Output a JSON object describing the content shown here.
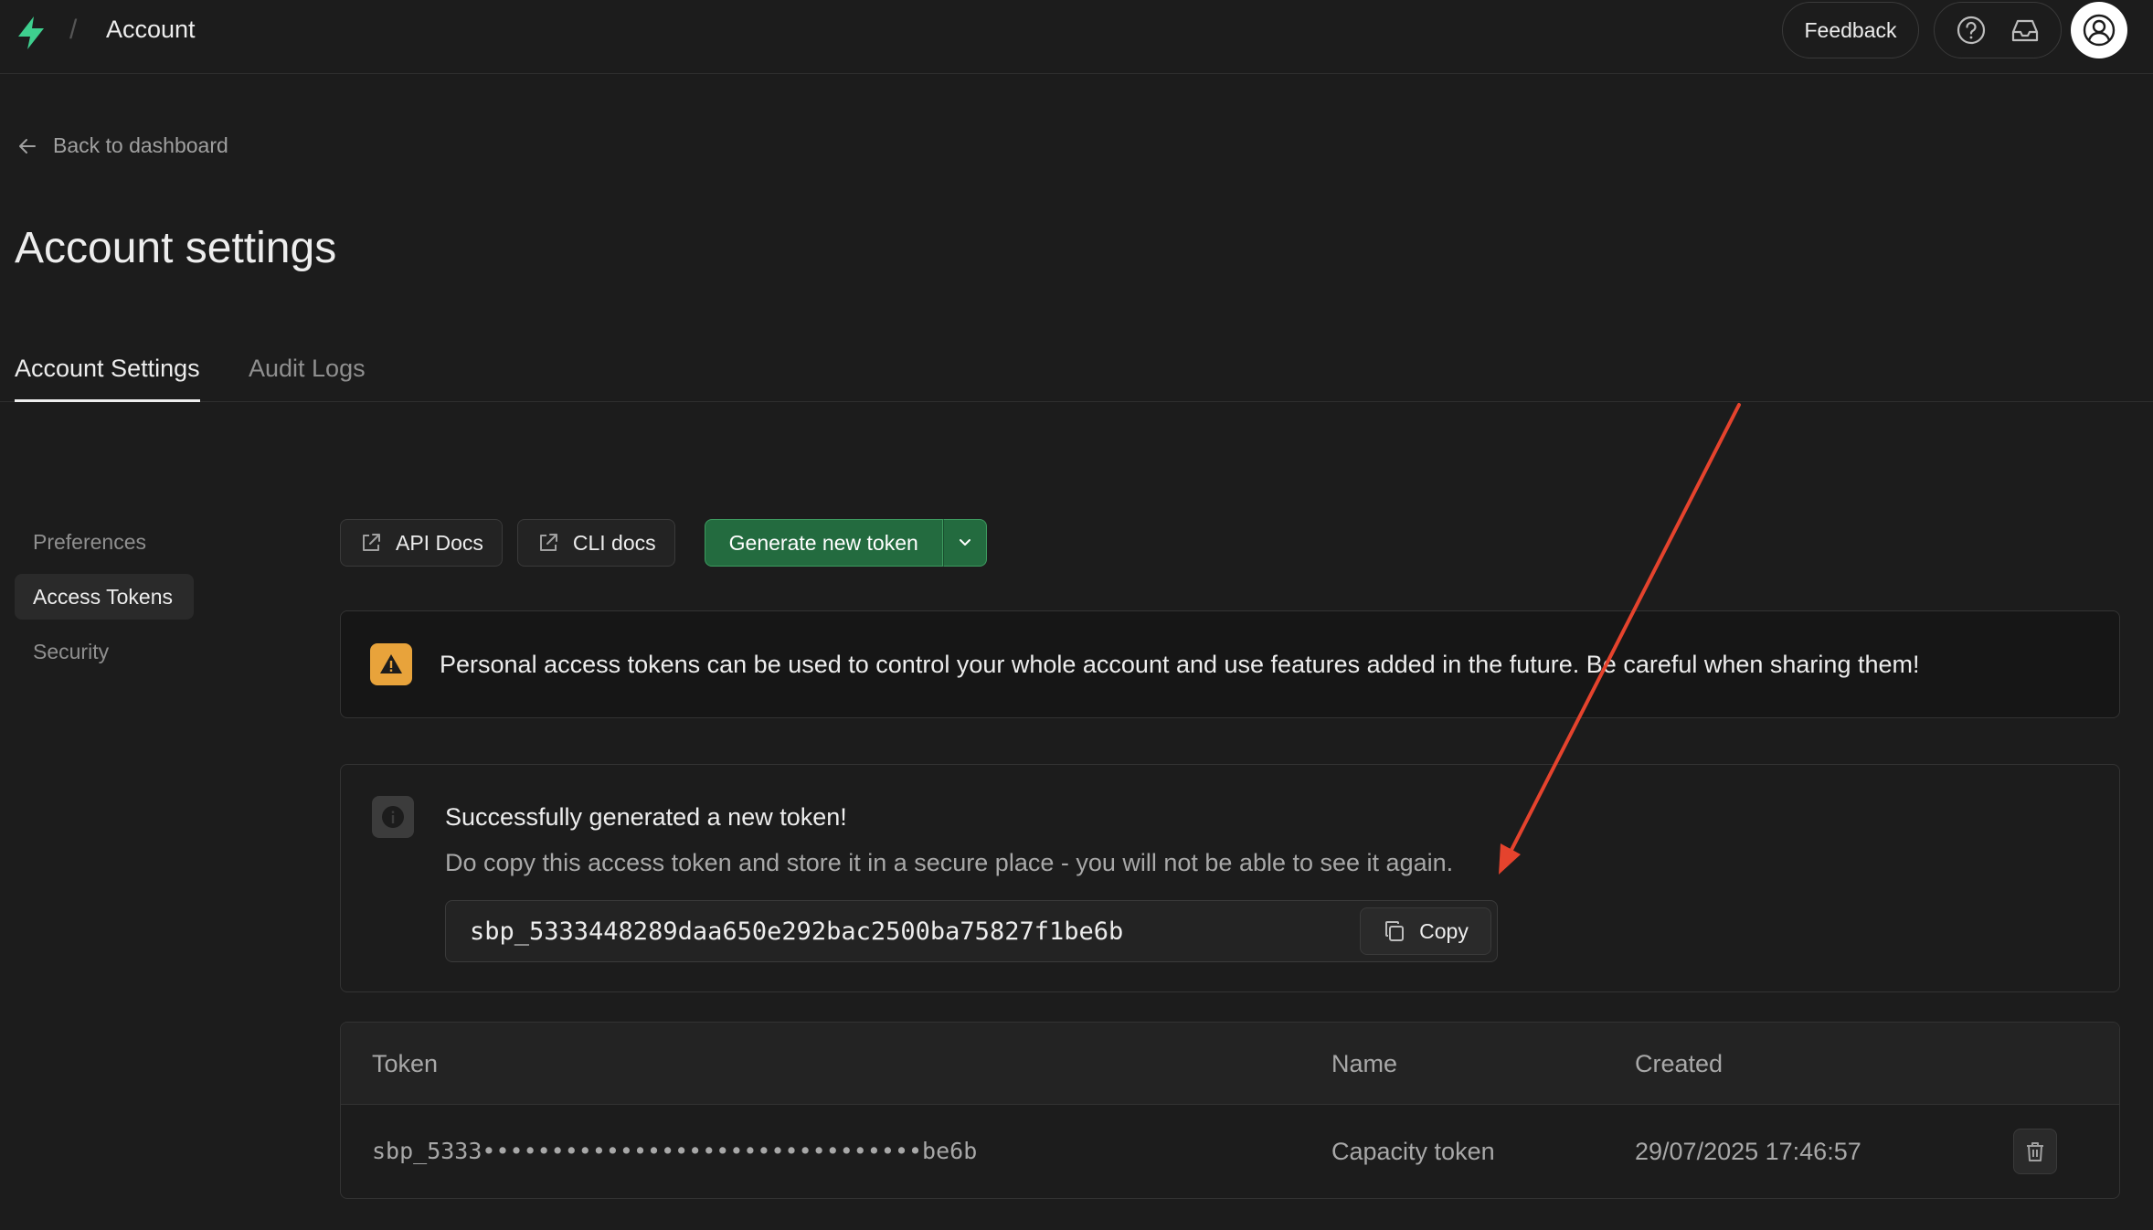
{
  "header": {
    "title": "Account",
    "separator": "/",
    "feedback_label": "Feedback",
    "icons": [
      "bolt-logo-icon",
      "help-icon",
      "inbox-icon",
      "user-icon"
    ],
    "brand_color": "#3ecf8e"
  },
  "nav": {
    "back_label": "Back to dashboard"
  },
  "page": {
    "title": "Account settings"
  },
  "tabs": [
    {
      "label": "Account Settings",
      "active": true
    },
    {
      "label": "Audit Logs",
      "active": false
    }
  ],
  "sidebar": {
    "items": [
      {
        "label": "Preferences",
        "active": false
      },
      {
        "label": "Access Tokens",
        "active": true
      },
      {
        "label": "Security",
        "active": false
      }
    ]
  },
  "toolbar": {
    "api_docs_label": "API Docs",
    "cli_docs_label": "CLI docs",
    "generate_label": "Generate new token",
    "generate_color": "#236b3f"
  },
  "warning": {
    "text": "Personal access tokens can be used to control your whole account and use features added in the future. Be careful when sharing them!",
    "icon_color": "#e8a33b"
  },
  "success": {
    "title": "Successfully generated a new token!",
    "description": "Do copy this access token and store it in a secure place - you will not be able to see it again.",
    "token": "sbp_5333448289daa650e292bac2500ba75827f1be6b",
    "copy_label": "Copy"
  },
  "tokens_table": {
    "columns": [
      "Token",
      "Name",
      "Created"
    ],
    "rows": [
      {
        "token": "sbp_5333••••••••••••••••••••••••••••••••be6b",
        "name": "Capacity token",
        "created": "29/07/2025 17:46:57"
      }
    ]
  },
  "annotation": {
    "arrow_color": "#e5432d"
  }
}
